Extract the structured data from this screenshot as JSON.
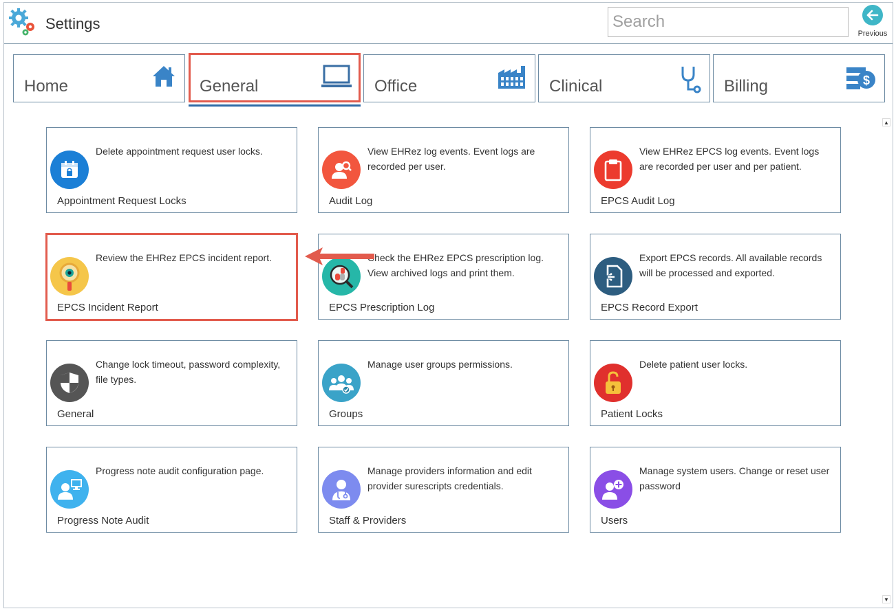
{
  "app": {
    "title": "Settings"
  },
  "search": {
    "placeholder": "Search"
  },
  "previous": {
    "label": "Previous"
  },
  "tabs": [
    {
      "label": "Home",
      "icon": "home-icon"
    },
    {
      "label": "General",
      "icon": "monitor-icon"
    },
    {
      "label": "Office",
      "icon": "factory-icon"
    },
    {
      "label": "Clinical",
      "icon": "stethoscope-icon"
    },
    {
      "label": "Billing",
      "icon": "billing-icon"
    }
  ],
  "active_tab": "General",
  "cards": [
    {
      "title": "Appointment Request Locks",
      "description": "Delete appointment request user locks.",
      "icon": "calendar-lock-icon",
      "color": "#1b7fd6"
    },
    {
      "title": "Audit Log",
      "description": "View EHRez log events. Event logs are recorded per user.",
      "icon": "user-search-icon",
      "color": "#f2563e"
    },
    {
      "title": "EPCS Audit Log",
      "description": "View EHRez EPCS log events. Event logs are recorded per user and per patient.",
      "icon": "clipboard-icon",
      "color": "#ec3b2e"
    },
    {
      "title": "EPCS Incident Report",
      "description": "Review the EHRez EPCS incident report.",
      "icon": "magnifier-eye-icon",
      "color": "#f5c64a"
    },
    {
      "title": "EPCS Prescription Log",
      "description": "Check the EHRez EPCS prescription log. View archived logs and print them.",
      "icon": "pill-magnifier-icon",
      "color": "#26b7a8"
    },
    {
      "title": "EPCS Record Export",
      "description": "Export EPCS records. All available records will be processed and exported.",
      "icon": "file-export-icon",
      "color": "#2d5d80"
    },
    {
      "title": "General",
      "description": "Change lock timeout, password complexity, file types.",
      "icon": "shield-icon",
      "color": "#555555"
    },
    {
      "title": "Groups",
      "description": "Manage user groups permissions.",
      "icon": "group-icon",
      "color": "#3aa3c8"
    },
    {
      "title": "Patient Locks",
      "description": "Delete patient user locks.",
      "icon": "padlock-icon",
      "color": "#e0302d"
    },
    {
      "title": "Progress Note Audit",
      "description": "Progress note audit configuration page.",
      "icon": "user-monitor-icon",
      "color": "#3fb2ee"
    },
    {
      "title": "Staff & Providers",
      "description": "Manage providers information and edit provider surescripts credentials.",
      "icon": "doctor-icon",
      "color": "#7d8bef"
    },
    {
      "title": "Users",
      "description": "Manage system users. Change or reset user password",
      "icon": "add-user-icon",
      "color": "#8a4ee6"
    }
  ],
  "colors": {
    "accent": "#2e6aa6",
    "highlight": "#e25b4d",
    "border": "#6d8ba3"
  }
}
